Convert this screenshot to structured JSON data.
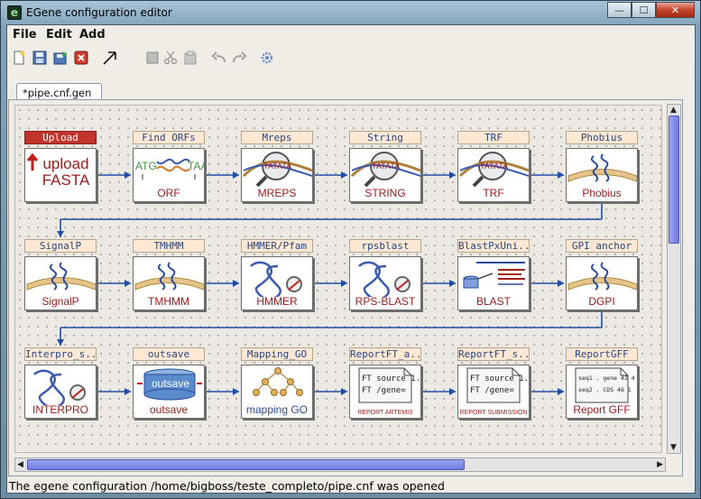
{
  "window": {
    "title": "EGene configuration editor",
    "app_icon": "e",
    "minimize": "—",
    "maximize": "☐",
    "close": "✕"
  },
  "menu": {
    "file": "File",
    "edit": "Edit",
    "add": "Add"
  },
  "toolbar": {
    "icons": [
      "new-file-icon",
      "save-icon",
      "save-as-icon",
      "close-file-icon",
      "pointer-arrow-icon",
      "delete-icon",
      "cut-icon",
      "paste-icon",
      "undo-icon",
      "redo-icon",
      "settings-gear-icon"
    ]
  },
  "tab": {
    "label": "*pipe.cnf.gen"
  },
  "rows": [
    [
      {
        "label": "Upload",
        "caption": "upload FASTA",
        "icon": "upload-icon",
        "selected": true
      },
      {
        "label": "Find ORFs",
        "caption": "ORF",
        "icon": "orf-icon"
      },
      {
        "label": "Mreps",
        "caption": "MREPS",
        "icon": "magnifier-dna-icon"
      },
      {
        "label": "String",
        "caption": "STRING",
        "icon": "magnifier-dna-icon"
      },
      {
        "label": "TRF",
        "caption": "TRF",
        "icon": "magnifier-dna-icon"
      },
      {
        "label": "Phobius",
        "caption": "Phobius",
        "icon": "membrane-protein-icon"
      }
    ],
    [
      {
        "label": "SignalP",
        "caption": "SignalP",
        "icon": "membrane-protein-icon"
      },
      {
        "label": "TMHMM",
        "caption": "TMHMM",
        "icon": "membrane-protein-icon"
      },
      {
        "label": "HMMER/Pfam",
        "caption": "HMMER",
        "icon": "protein-magnifier-icon"
      },
      {
        "label": "rpsblast",
        "caption": "RPS-BLAST",
        "icon": "protein-magnifier-icon"
      },
      {
        "label": "BlastPxUni...",
        "caption": "BLAST",
        "icon": "blast-icon"
      },
      {
        "label": "GPI anchor",
        "caption": "DGPI",
        "icon": "membrane-protein-icon"
      }
    ],
    [
      {
        "label": "Interpro_s...",
        "caption": "INTERPRO",
        "icon": "protein-magnifier-icon"
      },
      {
        "label": "outsave",
        "caption": "outsave",
        "icon": "database-icon"
      },
      {
        "label": "Mapping_GO",
        "caption": "mapping GO",
        "icon": "tree-icon"
      },
      {
        "label": "ReportFT_a...",
        "caption": "REPORT ARTEMIS",
        "icon": "report-icon",
        "doc_lines": [
          "FT source 1..",
          "FT    /gene="
        ]
      },
      {
        "label": "ReportFT_s...",
        "caption": "REPORT SUBMISSION",
        "icon": "report-icon",
        "doc_lines": [
          "FT source 1..",
          "FT    /gene="
        ]
      },
      {
        "label": "ReportGFF",
        "caption": "Report GFF",
        "icon": "report-icon",
        "doc_lines": [
          "seq1 . gene 42 4",
          "seq2 . CDS  46 1"
        ]
      }
    ]
  ],
  "status": "The egene configuration /home/bigboss/teste_completo/pipe.cnf was opened",
  "colors": {
    "edge": "#1d4ea3",
    "label_bg": "#fde9d3",
    "label_text": "#23468a",
    "caption": "#a01c1c",
    "selected_label": "#c0342c"
  }
}
